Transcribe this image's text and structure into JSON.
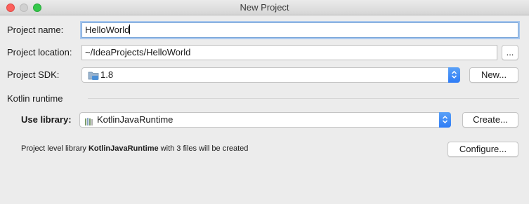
{
  "window": {
    "title": "New Project"
  },
  "form": {
    "project_name_label": "Project name:",
    "project_name_value": "HelloWorld",
    "project_location_label": "Project location:",
    "project_location_value": "~/IdeaProjects/HelloWorld",
    "browse_label": "...",
    "project_sdk_label": "Project SDK:",
    "project_sdk_value": "1.8",
    "new_button_label": "New..."
  },
  "kotlin": {
    "section_title": "Kotlin runtime",
    "use_library_label": "Use library:",
    "library_value": "KotlinJavaRuntime",
    "create_button_label": "Create...",
    "info_prefix": "Project level library ",
    "info_library": "KotlinJavaRuntime",
    "info_suffix": " with 3 files will be created",
    "configure_button_label": "Configure..."
  },
  "icons": {
    "sdk": "folder-icon",
    "library": "library-icon",
    "combo_arrow": "chevron-updown-icon"
  },
  "colors": {
    "accent": "#2e7cf6",
    "focus_ring": "#a9c8ee",
    "window_bg": "#ececec"
  }
}
